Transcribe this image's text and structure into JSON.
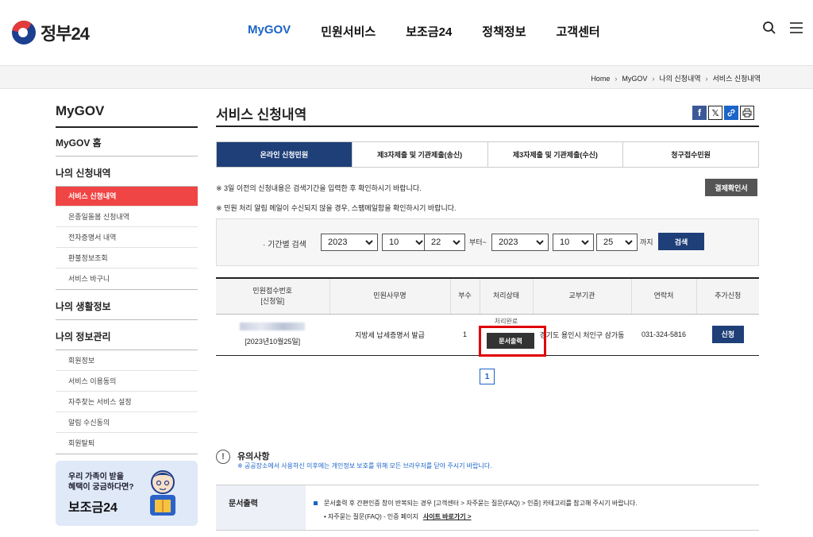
{
  "header": {
    "logo_text": "정부24",
    "nav": [
      "MyGOV",
      "민원서비스",
      "보조금24",
      "정책정보",
      "고객센터"
    ],
    "active_nav": "MyGOV"
  },
  "breadcrumb": [
    "Home",
    "MyGOV",
    "나의 신청내역",
    "서비스 신청내역"
  ],
  "sidebar": {
    "title": "MyGOV",
    "home": "MyGOV 홈",
    "section1": "나의 신청내역",
    "section1_items": [
      "서비스 신청내역",
      "온종일돌봄 신청내역",
      "전자증명서 내역",
      "환불정보조회",
      "서비스 바구니"
    ],
    "section2": "나의 생활정보",
    "section3": "나의 정보관리",
    "section3_items": [
      "회원정보",
      "서비스 이용동의",
      "자주찾는 서비스 설정",
      "알림 수신동의",
      "회원탈퇴"
    ],
    "banner_line1": "우리 가족이 받을",
    "banner_line2": "혜택이 궁금하다면?",
    "banner_title": "보조금24"
  },
  "main": {
    "title": "서비스 신청내역",
    "tabs": [
      "온라인 신청민원",
      "제3자제출 및 기관제출(송신)",
      "제3자제출 및 기관제출(수신)",
      "청구접수민원"
    ],
    "active_tab": 0,
    "note1": "※ 3일 이전의 신청내용은 검색기간을 입력한 후 확인하시기 바랍니다.",
    "note2": "※ 민원 처리 알림 메일이 수신되지 않을 경우, 스팸메일함을 확인하시기 바랍니다.",
    "receipt_button": "결제확인서",
    "search": {
      "label": "· 기간별 검색",
      "from_year": "2023",
      "from_month": "10",
      "from_day": "22",
      "from_suffix": "부터~",
      "to_year": "2023",
      "to_month": "10",
      "to_day": "25",
      "to_suffix": "까지",
      "button": "검색"
    },
    "table": {
      "headers": [
        "민원접수번호\n[신청일]",
        "민원사무명",
        "부수",
        "처리상태",
        "교부기관",
        "연락처",
        "추가신청"
      ],
      "row": {
        "date": "[2023년10월25일]",
        "name": "지방세 납세증명서 발급",
        "copies": "1",
        "status": "처리완료",
        "status_button": "문서출력",
        "agency": "경기도 용인시 처인구 삼가동",
        "phone": "031-324-5816",
        "apply_button": "신청"
      }
    },
    "page": "1",
    "notice": {
      "title": "유의사항",
      "text": "※ 공공장소에서 사용하신 이후에는 개인정보 보호를 위해 모든 브라우저를 닫아 주시기 바랍니다.",
      "box_label": "문서출력",
      "box_line1": "문서출력 후 간편인증 창이 반복되는 경우 [고객센터 > 자주묻는 질문(FAQ) > 인증] 카테고리를 참고해 주시기 바랍니다.",
      "box_line2": "• 자주묻는 질문(FAQ) - 인증 페이지",
      "box_link": "사이트 바로가기 >"
    }
  }
}
